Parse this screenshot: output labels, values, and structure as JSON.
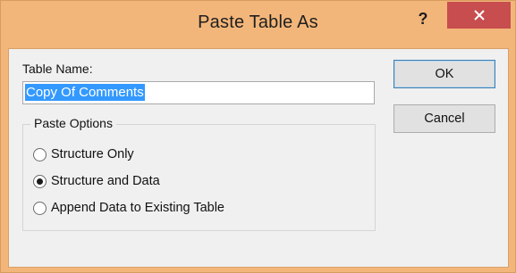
{
  "dialog": {
    "title": "Paste Table As",
    "help_label": "?",
    "close_icon": "close-icon"
  },
  "table_name": {
    "label": "Table Name:",
    "value": "Copy Of Comments"
  },
  "paste_options": {
    "legend": "Paste Options",
    "options": [
      {
        "label": "Structure Only",
        "checked": false
      },
      {
        "label": "Structure and Data",
        "checked": true
      },
      {
        "label": "Append Data to Existing Table",
        "checked": false
      }
    ]
  },
  "buttons": {
    "ok_label": "OK",
    "cancel_label": "Cancel"
  },
  "colors": {
    "frame": "#f3b67a",
    "close_button": "#c74d4e",
    "selection": "#3399ff",
    "client": "#f0f0f0"
  }
}
